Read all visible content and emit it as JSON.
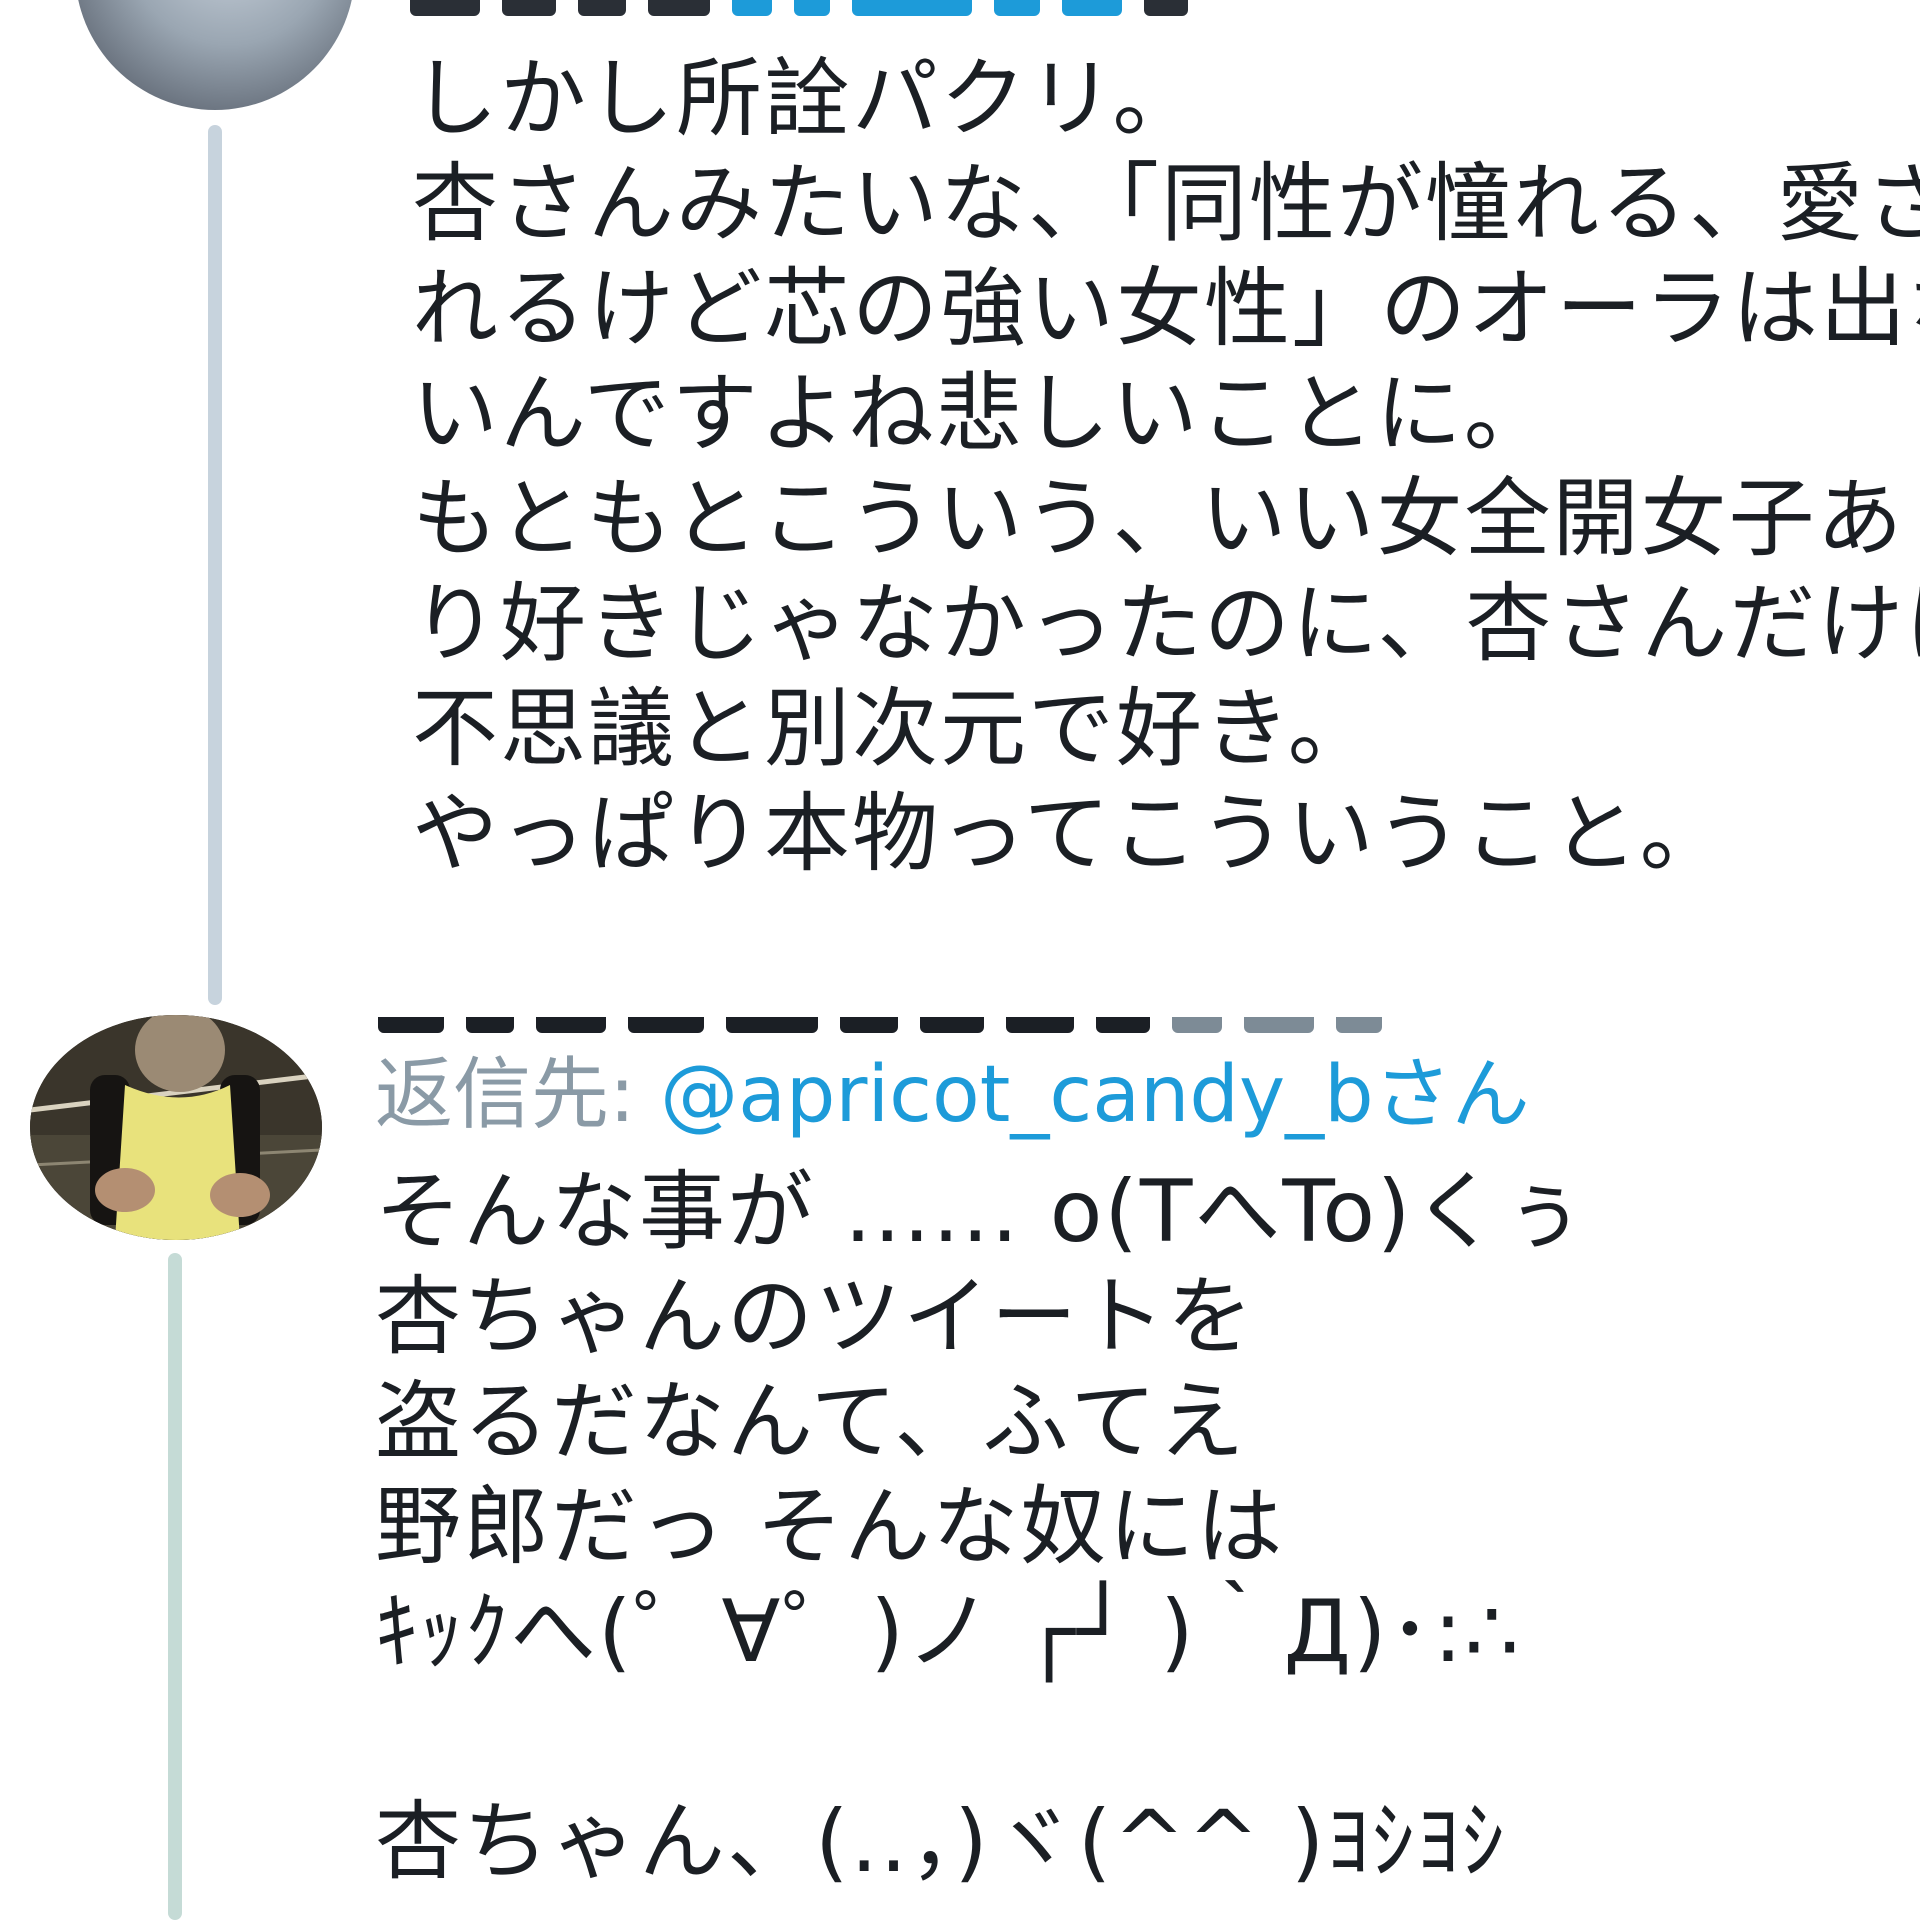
{
  "tweets": [
    {
      "text": "しかし所詮パクリ。\n杏さんみたいな、「同性が憧れる、愛さ\nれるけど芯の強い女性」のオーラは出な\nいんですよね悲しいことに。\nもともとこういう、いい女全開女子あま\nり好きじゃなかったのに、杏さんだけは\n不思議と別次元で好き。\nやっぱり本物ってこういうこと。"
    },
    {
      "reply_label": "返信先:",
      "reply_handle": "@apricot_candy_bさん",
      "text": "そんな事が ...... o(TへTo)くぅ\n杏ちゃんのツイートを\n盗るだなんて、ふてえ\n野郎だっ そんな奴には\nｷｯｸへ(゜∀゜)ノ ┌┘ )｀Д)･:∴\n\n杏ちゃん、(..，)ヾ(^^ )ﾖｼﾖｼ"
    }
  ],
  "icons": {
    "avatar_1": "user-avatar-grey",
    "avatar_2": "user-avatar-photo"
  },
  "colors": {
    "link": "#1d9bd9",
    "muted": "#8a9aa6",
    "thread_line_1": "#c7d3dd",
    "thread_line_2": "#c5dbd6",
    "text": "#1b1f24"
  }
}
